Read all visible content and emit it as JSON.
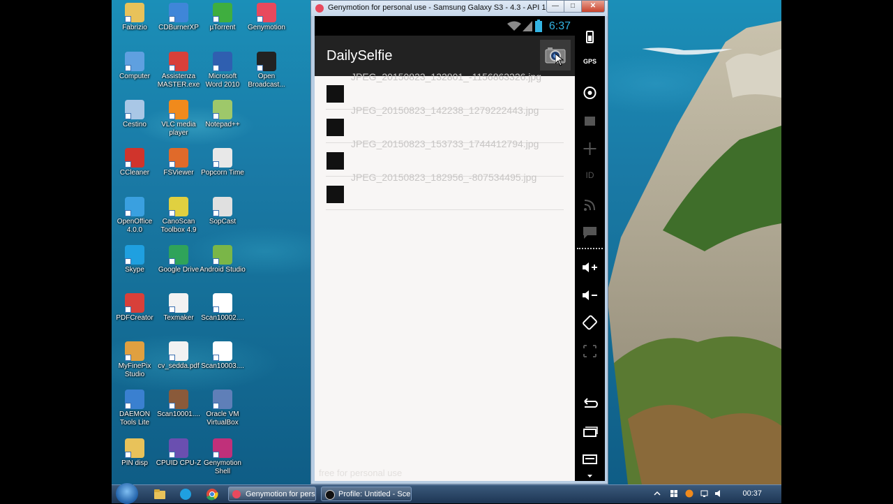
{
  "desktop": {
    "icons": [
      {
        "label": "Fabrizio",
        "color": "#e8c25a"
      },
      {
        "label": "CDBurnerXP",
        "color": "#3f86d8"
      },
      {
        "label": "µTorrent",
        "color": "#3fae3f"
      },
      {
        "label": "Genymotion",
        "color": "#e8495d"
      },
      {
        "label": "Computer",
        "color": "#5fa0e0"
      },
      {
        "label": "Assistenza MASTER.exe",
        "color": "#d8403a"
      },
      {
        "label": "Microsoft Word 2010",
        "color": "#2f5fb0"
      },
      {
        "label": "Open Broadcast...",
        "color": "#222222"
      },
      {
        "label": "Cestino",
        "color": "#a9c7e6"
      },
      {
        "label": "VLC media player",
        "color": "#f08a1c"
      },
      {
        "label": "Notepad++",
        "color": "#9ec86a"
      },
      {
        "label": "CCleaner",
        "color": "#d0342c"
      },
      {
        "label": "FSViewer",
        "color": "#e06a2a"
      },
      {
        "label": "Popcorn Time",
        "color": "#e8e8e8"
      },
      {
        "label": "OpenOffice 4.0.0",
        "color": "#3aa0e0"
      },
      {
        "label": "CanoScan Toolbox 4.9",
        "color": "#e0d040"
      },
      {
        "label": "SopCast",
        "color": "#e0e0e0"
      },
      {
        "label": "Skype",
        "color": "#1fa0e0"
      },
      {
        "label": "Google Drive",
        "color": "#2fa35a"
      },
      {
        "label": "Android Studio",
        "color": "#7ab648"
      },
      {
        "label": "PDFCreator",
        "color": "#d8403a"
      },
      {
        "label": "Texmaker",
        "color": "#f2f2f2"
      },
      {
        "label": "Scan10002....",
        "color": "#ffffff"
      },
      {
        "label": "MyFinePix Studio",
        "color": "#e0a040"
      },
      {
        "label": "cv_sedda.pdf",
        "color": "#f2f2f2"
      },
      {
        "label": "Scan10003....",
        "color": "#ffffff"
      },
      {
        "label": "DAEMON Tools Lite",
        "color": "#3a80d0"
      },
      {
        "label": "Scan10001....",
        "color": "#8a5a3a"
      },
      {
        "label": "Oracle VM VirtualBox",
        "color": "#5f7fb8"
      },
      {
        "label": "PIN disp",
        "color": "#e8c25a"
      },
      {
        "label": "CPUID CPU-Z",
        "color": "#6a4fb0"
      },
      {
        "label": "Genymotion Shell",
        "color": "#c0307a"
      }
    ]
  },
  "window": {
    "title": "Genymotion for personal use - Samsung Galaxy S3 - 4.3 - API 18 - 7...",
    "minimize": "—",
    "maximize": "□",
    "close": "✕"
  },
  "phone": {
    "clock": "6:37",
    "app_title": "DailySelfie",
    "files": [
      "JPEG_20150823_132801_-1156863326.jpg",
      "JPEG_20150823_142238_1279222443.jpg",
      "JPEG_20150823_153733_1744412794.jpg",
      "JPEG_20150823_182956_-807534495.jpg"
    ],
    "watermark": "free for personal use"
  },
  "sidebar": {
    "gps": "GPS",
    "id": "ID"
  },
  "taskbar": {
    "tasks": [
      "Genymotion for pers...",
      "Profile: Untitled - Sce..."
    ],
    "time": "00:37"
  }
}
